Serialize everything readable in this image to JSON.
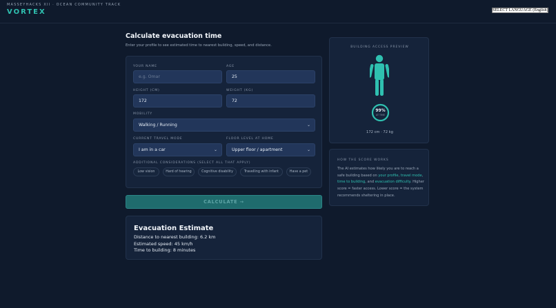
{
  "header": {
    "event": "MASSEYHACKS XII · OCEAN COMMUNITY TRACK",
    "brand": "VORTEX",
    "language_button": "SELECT LANGUAGE (English)"
  },
  "page": {
    "title": "Calculate evacuation time",
    "subtitle": "Enter your profile to see estimated time to nearest building, speed, and distance."
  },
  "form": {
    "name_label": "YOUR NAME",
    "name_placeholder": "e.g. Omar",
    "age_label": "AGE",
    "age_value": "25",
    "height_label": "HEIGHT (CM)",
    "height_value": "172",
    "weight_label": "WEIGHT (KG)",
    "weight_value": "72",
    "mobility_label": "MOBILITY",
    "mobility_value": "Walking / Running",
    "travel_label": "CURRENT TRAVEL MODE",
    "travel_value": "I am in a car",
    "floor_label": "FLOOR LEVEL AT HOME",
    "floor_value": "Upper floor / apartment",
    "considerations_label": "ADDITIONAL CONSIDERATIONS (SELECT ALL THAT APPLY)",
    "considerations": [
      "Low vision",
      "Hard of hearing",
      "Cognitive disability",
      "Travelling with infant",
      "Have a pet"
    ]
  },
  "calculate_button": "CALCULATE →",
  "result": {
    "title": "Evacuation Estimate",
    "distance": "Distance to nearest building: 6.2 km",
    "speed": "Estimated speed: 45 km/h",
    "time": "Time to building: 8 minutes"
  },
  "preview": {
    "title": "BUILDING ACCESS PREVIEW",
    "score": "99%",
    "score_sub": "AT TIME",
    "score_fraction": 0.99,
    "metrics": "172 cm · 72 kg"
  },
  "info": {
    "title": "HOW THE SCORE WORKS",
    "t1": "The AI estimates how likely you are to reach a safe building based on ",
    "h1": "your profile",
    "t2": ", ",
    "h2": "travel mode",
    "t3": ", ",
    "h3": "time to building",
    "t4": ", and ",
    "h4": "evacuation difficulty",
    "t5": ". Higher score = faster access. Lower score = the system recommends sheltering in place."
  },
  "colors": {
    "accent": "#2fc0b0",
    "background": "#0f1a2c",
    "card": "#15233a"
  }
}
